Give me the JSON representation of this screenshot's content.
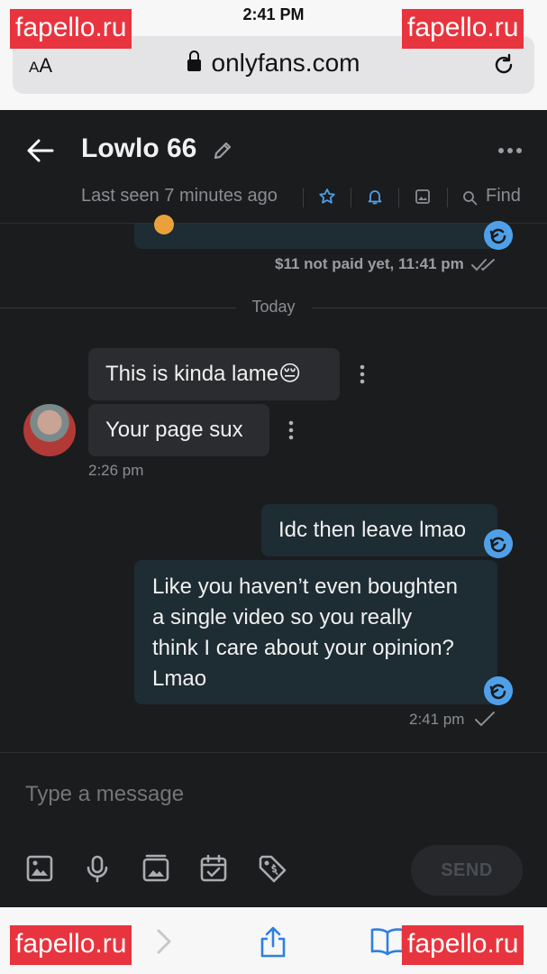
{
  "status_bar": {
    "time": "2:41 PM"
  },
  "browser": {
    "aa_label_small": "A",
    "aa_label_large": "A",
    "url": "onlyfans.com"
  },
  "watermark": {
    "text": "fapello.ru"
  },
  "chat_header": {
    "contact_name": "Lowlo 66",
    "last_seen": "Last seen 7 minutes ago",
    "find_label": "Find"
  },
  "messages": {
    "prev_meta": "$11 not paid yet, 11:41 pm",
    "day_divider": "Today",
    "incoming": [
      {
        "text": "This is kinda lame😔"
      },
      {
        "text": "Your page sux"
      }
    ],
    "incoming_time": "2:26 pm",
    "outgoing": [
      {
        "text": "Idc then leave lmao"
      },
      {
        "lines": [
          "Like you haven’t even boughten",
          "a single video so you really",
          "think I care about your opinion?",
          "Lmao"
        ]
      }
    ],
    "outgoing_time": "2:41 pm"
  },
  "composer": {
    "placeholder": "Type a message",
    "send_label": "SEND"
  },
  "colors": {
    "accent": "#4fa0e8",
    "background": "#1b1c1e",
    "outgoing_bubble": "#1e2c33",
    "incoming_bubble": "#2b2c2f",
    "watermark": "#e8343e"
  },
  "icons": {
    "header": [
      "back-arrow-icon",
      "pencil-icon",
      "more-icon",
      "star-icon",
      "bell-icon",
      "image-icon",
      "search-icon"
    ],
    "composer": [
      "image-icon",
      "microphone-icon",
      "gallery-icon",
      "calendar-icon",
      "price-tag-icon"
    ],
    "browser": [
      "lock-icon",
      "reload-icon",
      "forward-icon",
      "share-icon",
      "bookmarks-icon"
    ]
  }
}
